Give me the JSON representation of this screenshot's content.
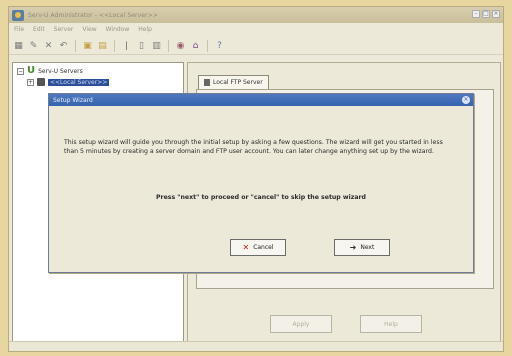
{
  "window": {
    "title": "Serv-U Administrator - <<Local Server>>",
    "controls": [
      "minimize",
      "maximize",
      "close"
    ]
  },
  "menubar": [
    "File",
    "Edit",
    "Server",
    "View",
    "Window",
    "Help"
  ],
  "toolbar": {
    "icons": [
      "grid-icon",
      "pin-icon",
      "cut-icon",
      "undo-icon",
      "copy-icon",
      "paste-icon",
      "info-icon",
      "page-icon",
      "trash-icon",
      "globe-icon",
      "home-icon",
      "help-icon"
    ]
  },
  "tree": {
    "root_label": "Serv-U Servers",
    "child_label": "<<Local Server>>",
    "root_expander": "−",
    "child_expander": "+"
  },
  "right_tab": {
    "label": "Local FTP Server"
  },
  "bottom_buttons": {
    "apply": "Apply",
    "help": "Help"
  },
  "dialog": {
    "title": "Setup Wizard",
    "body": "This setup wizard will guide you through the initial setup by asking a few questions. The wizard will get you started in less than 5 minutes by creating a server domain and FTP user account. You can later change anything set up by the wizard.",
    "prompt": "Press \"next\" to proceed or \"cancel\" to skip the setup wizard",
    "cancel_label": "Cancel",
    "next_label": "Next"
  }
}
